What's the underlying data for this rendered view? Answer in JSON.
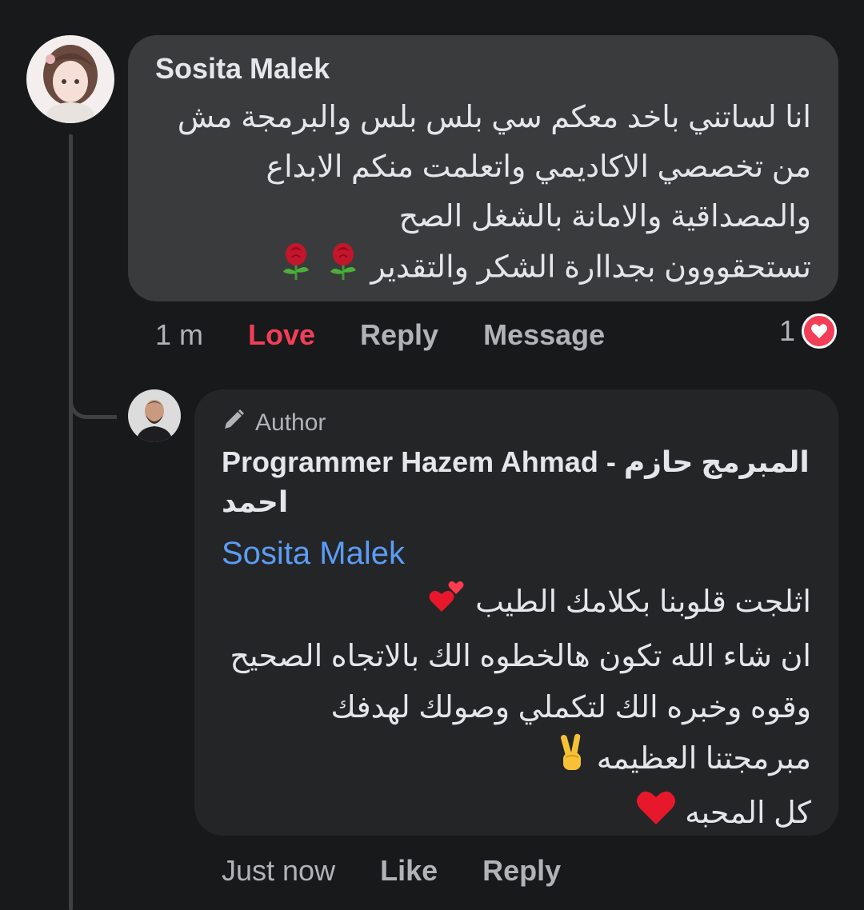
{
  "comment": {
    "author": "Sosita Malek",
    "lines": [
      "انا لساتني باخد معكم سي بلس بلس والبرمجة مش",
      "من تخصصي الاكاديمي واتعلمت منكم الابداع",
      "والمصداقية والامانة بالشغل الصح",
      "تستحقووون بجداارة الشكر والتقدير"
    ],
    "last_line_emoji": "rose-icon",
    "actions": {
      "time": "1 m",
      "love": "Love",
      "reply": "Reply",
      "message": "Message"
    },
    "reaction_count": "1",
    "reaction_icon": "heart-icon"
  },
  "reply": {
    "badge": "Author",
    "author_line1": "Programmer Hazem Ahmad - المبرمج حازم",
    "author_line2": "احمد",
    "mention": "Sosita Malek",
    "lines": [
      "اثلجت قلوبنا بكلامك الطيب",
      "ان شاء الله تكون هالخطوه الك بالاتجاه الصحيح",
      "وقوه وخبره الك لتكملي وصولك لهدفك",
      "مبرمجتنا العظيمه",
      "كل المحبه"
    ],
    "line_emojis": [
      "two-hearts-icon",
      "",
      "",
      "victory-hand-icon",
      "red-heart-icon"
    ],
    "actions": {
      "time": "Just now",
      "like": "Like",
      "reply": "Reply"
    }
  },
  "colors": {
    "background": "#18191a",
    "bubble": "#3a3b3c",
    "bubble_reply": "#242526",
    "love": "#f33e58",
    "mention": "#5b9cf6",
    "muted": "#b0b3b8"
  }
}
